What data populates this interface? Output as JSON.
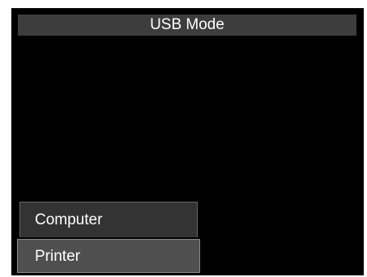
{
  "title": "USB Mode",
  "menu": {
    "items": [
      {
        "label": "Computer",
        "selected": false
      },
      {
        "label": "Printer",
        "selected": true
      }
    ]
  },
  "colors": {
    "background": "#000000",
    "title_bar": "#3d3d3d",
    "menu_item": "#333333",
    "menu_item_selected": "#4f4f4f",
    "text": "#ffffff"
  }
}
